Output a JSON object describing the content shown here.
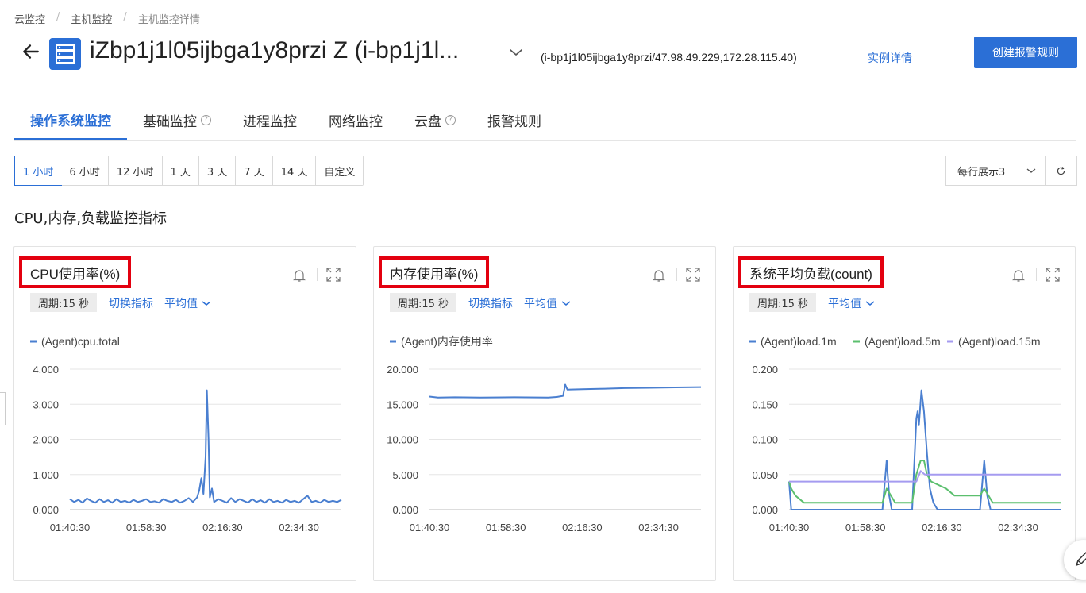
{
  "breadcrumb": [
    "云监控",
    "主机监控",
    "主机监控详情"
  ],
  "header": {
    "title": "iZbp1j1l05ijbga1y8przi Z (i-bp1j1l...",
    "sub_info": "(i-bp1j1l05ijbga1y8przi/47.98.49.229,172.28.115.40)",
    "instance_link": "实例详情",
    "create_button": "创建报警规则"
  },
  "tabs": [
    {
      "label": "操作系统监控",
      "active": true,
      "help": false
    },
    {
      "label": "基础监控",
      "active": false,
      "help": true
    },
    {
      "label": "进程监控",
      "active": false,
      "help": false
    },
    {
      "label": "网络监控",
      "active": false,
      "help": false
    },
    {
      "label": "云盘",
      "active": false,
      "help": true
    },
    {
      "label": "报警规则",
      "active": false,
      "help": false
    }
  ],
  "time_ranges": [
    "1 小时",
    "6 小时",
    "12 小时",
    "1 天",
    "3 天",
    "7 天",
    "14 天",
    "自定义"
  ],
  "selected_range": "1 小时",
  "per_row": "每行展示3",
  "section_title": "CPU,内存,负载监控指标",
  "common": {
    "period": "周期:15 秒",
    "switch_metric": "切换指标",
    "aggregation": "平均值"
  },
  "colors": {
    "blue": "#4a7fd0",
    "green": "#5bbf6e",
    "purple": "#a59bf0",
    "accent": "#2b6fd6",
    "highlight_box": "#e3000f"
  },
  "chart_data": [
    {
      "type": "line",
      "title": "CPU使用率(%)",
      "ylim": [
        0,
        4
      ],
      "y_ticks": [
        "4.000",
        "3.000",
        "2.000",
        "1.000",
        "0.000"
      ],
      "x_ticks": [
        "01:40:30",
        "01:58:30",
        "02:16:30",
        "02:34:30"
      ],
      "x_range_minutes": [
        0,
        64
      ],
      "series": [
        {
          "name": "(Agent)cpu.total",
          "color": "#4a7fd0",
          "points": [
            [
              0,
              0.3
            ],
            [
              1,
              0.22
            ],
            [
              2,
              0.28
            ],
            [
              3,
              0.2
            ],
            [
              4,
              0.32
            ],
            [
              5,
              0.25
            ],
            [
              6,
              0.2
            ],
            [
              7,
              0.3
            ],
            [
              8,
              0.22
            ],
            [
              9,
              0.27
            ],
            [
              10,
              0.2
            ],
            [
              11,
              0.3
            ],
            [
              12,
              0.22
            ],
            [
              13,
              0.25
            ],
            [
              14,
              0.2
            ],
            [
              15,
              0.28
            ],
            [
              16,
              0.22
            ],
            [
              17,
              0.25
            ],
            [
              18,
              0.3
            ],
            [
              19,
              0.22
            ],
            [
              20,
              0.24
            ],
            [
              21,
              0.2
            ],
            [
              22,
              0.3
            ],
            [
              23,
              0.25
            ],
            [
              24,
              0.22
            ],
            [
              25,
              0.28
            ],
            [
              26,
              0.2
            ],
            [
              27,
              0.25
            ],
            [
              28,
              0.33
            ],
            [
              29,
              0.22
            ],
            [
              30,
              0.35
            ],
            [
              30.5,
              0.55
            ],
            [
              31,
              0.9
            ],
            [
              31.5,
              0.45
            ],
            [
              32,
              1.5
            ],
            [
              32.3,
              3.4
            ],
            [
              32.7,
              2.0
            ],
            [
              33,
              0.35
            ],
            [
              33.5,
              0.6
            ],
            [
              34,
              0.22
            ],
            [
              35,
              0.3
            ],
            [
              36,
              0.25
            ],
            [
              37,
              0.2
            ],
            [
              38,
              0.33
            ],
            [
              39,
              0.22
            ],
            [
              40,
              0.3
            ],
            [
              41,
              0.25
            ],
            [
              42,
              0.2
            ],
            [
              43,
              0.3
            ],
            [
              44,
              0.22
            ],
            [
              45,
              0.27
            ],
            [
              46,
              0.2
            ],
            [
              47,
              0.3
            ],
            [
              48,
              0.22
            ],
            [
              49,
              0.25
            ],
            [
              50,
              0.2
            ],
            [
              51,
              0.28
            ],
            [
              52,
              0.22
            ],
            [
              53,
              0.25
            ],
            [
              54,
              0.2
            ],
            [
              55,
              0.3
            ],
            [
              56,
              0.4
            ],
            [
              57,
              0.22
            ],
            [
              58,
              0.25
            ],
            [
              59,
              0.2
            ],
            [
              60,
              0.28
            ],
            [
              61,
              0.22
            ],
            [
              62,
              0.25
            ],
            [
              63,
              0.22
            ],
            [
              64,
              0.28
            ]
          ]
        }
      ]
    },
    {
      "type": "line",
      "title": "内存使用率(%)",
      "ylim": [
        0,
        20
      ],
      "y_ticks": [
        "20.000",
        "15.000",
        "10.000",
        "5.000",
        "0.000"
      ],
      "x_ticks": [
        "01:40:30",
        "01:58:30",
        "02:16:30",
        "02:34:30"
      ],
      "x_range_minutes": [
        0,
        64
      ],
      "series": [
        {
          "name": "(Agent)内存使用率",
          "color": "#4a7fd0",
          "points": [
            [
              0,
              16.1
            ],
            [
              2,
              15.95
            ],
            [
              6,
              16.0
            ],
            [
              12,
              15.95
            ],
            [
              20,
              16.0
            ],
            [
              28,
              15.95
            ],
            [
              30,
              16.05
            ],
            [
              31.5,
              16.2
            ],
            [
              32,
              17.8
            ],
            [
              32.5,
              17.1
            ],
            [
              36,
              17.15
            ],
            [
              40,
              17.2
            ],
            [
              46,
              17.3
            ],
            [
              52,
              17.35
            ],
            [
              58,
              17.4
            ],
            [
              64,
              17.45
            ]
          ]
        }
      ]
    },
    {
      "type": "line",
      "title": "系统平均负载(count)",
      "ylim": [
        0,
        0.2
      ],
      "y_ticks": [
        "0.200",
        "0.150",
        "0.100",
        "0.050",
        "0.000"
      ],
      "x_ticks": [
        "01:40:30",
        "01:58:30",
        "02:16:30",
        "02:34:30"
      ],
      "x_range_minutes": [
        0,
        64
      ],
      "series": [
        {
          "name": "(Agent)load.1m",
          "color": "#4a7fd0",
          "points": [
            [
              0,
              0.04
            ],
            [
              0.5,
              0.0
            ],
            [
              22,
              0.0
            ],
            [
              23,
              0.07
            ],
            [
              23.6,
              0.02
            ],
            [
              24.2,
              0.0
            ],
            [
              29,
              0.0
            ],
            [
              30,
              0.13
            ],
            [
              30.3,
              0.14
            ],
            [
              30.6,
              0.12
            ],
            [
              31.2,
              0.17
            ],
            [
              31.8,
              0.14
            ],
            [
              32.5,
              0.08
            ],
            [
              33.2,
              0.03
            ],
            [
              34,
              0.01
            ],
            [
              35,
              0.0
            ],
            [
              45,
              0.0
            ],
            [
              46,
              0.07
            ],
            [
              46.7,
              0.02
            ],
            [
              47.5,
              0.0
            ],
            [
              64,
              0.0
            ]
          ]
        },
        {
          "name": "(Agent)load.5m",
          "color": "#5bbf6e",
          "points": [
            [
              0,
              0.04
            ],
            [
              0.5,
              0.03
            ],
            [
              1.5,
              0.02
            ],
            [
              3.5,
              0.01
            ],
            [
              22,
              0.01
            ],
            [
              23,
              0.03
            ],
            [
              24,
              0.02
            ],
            [
              25,
              0.01
            ],
            [
              29,
              0.01
            ],
            [
              30,
              0.05
            ],
            [
              31,
              0.07
            ],
            [
              31.8,
              0.07
            ],
            [
              32.5,
              0.05
            ],
            [
              33.5,
              0.04
            ],
            [
              37,
              0.03
            ],
            [
              39,
              0.02
            ],
            [
              45,
              0.02
            ],
            [
              46,
              0.03
            ],
            [
              47,
              0.02
            ],
            [
              48,
              0.01
            ],
            [
              64,
              0.01
            ]
          ]
        },
        {
          "name": "(Agent)load.15m",
          "color": "#a59bf0",
          "points": [
            [
              0,
              0.04
            ],
            [
              30,
              0.04
            ],
            [
              31,
              0.055
            ],
            [
              32,
              0.05
            ],
            [
              64,
              0.05
            ]
          ]
        }
      ]
    }
  ]
}
